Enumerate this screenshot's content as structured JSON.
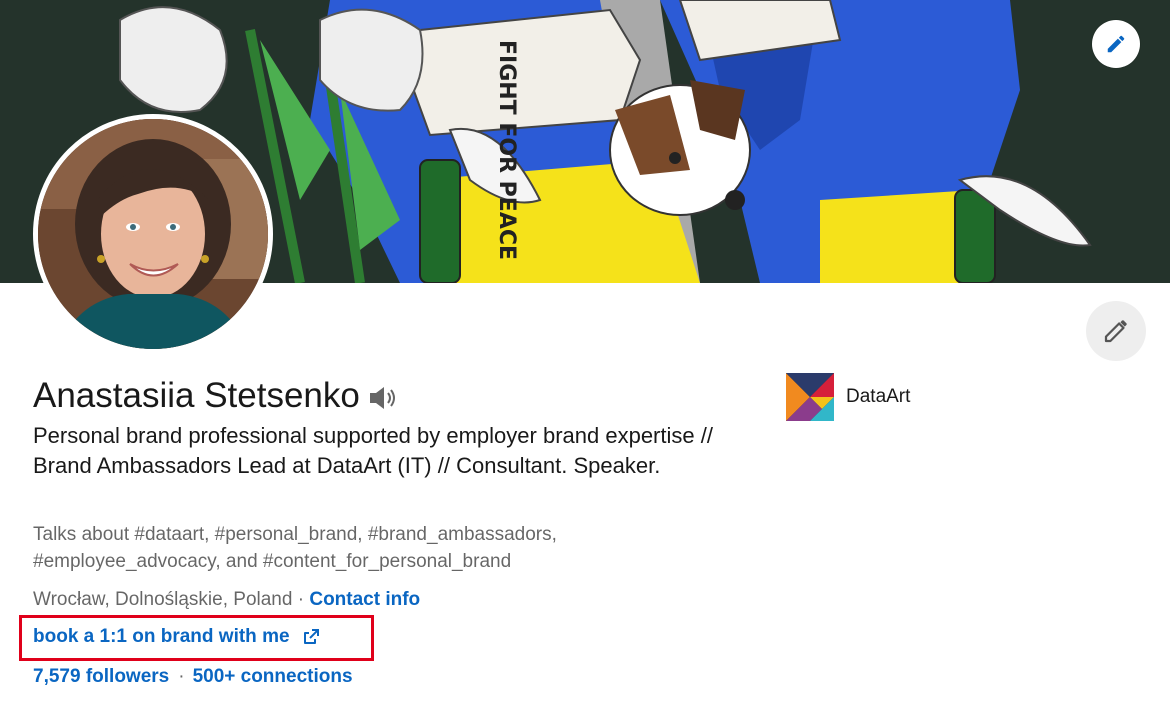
{
  "profile": {
    "name": "Anastasiia Stetsenko",
    "headline": "Personal brand professional supported by employer brand expertise // Brand Ambassadors Lead at DataArt (IT) // Consultant. Speaker.",
    "talks_about": "Talks about #dataart, #personal_brand, #brand_ambassadors, #employee_advocacy, and #content_for_personal_brand",
    "location": "Wrocław, Dolnośląskie, Poland",
    "location_separator": " · ",
    "contact_info_label": "Contact info",
    "website_label": "book a 1:1 on brand with me",
    "followers": "7,579 followers",
    "network_separator": "·",
    "connections": "500+ connections"
  },
  "banner": {
    "text": "FIGHT FOR PEACE"
  },
  "company": {
    "name": "DataArt"
  },
  "icons": {
    "banner_edit": "pencil-icon",
    "profile_edit": "pencil-icon",
    "name_pronunciation": "speaker-icon",
    "external_link": "external-link-icon",
    "company_logo": "dataart-logo"
  },
  "colors": {
    "link": "#0a66c2",
    "highlight_box": "#e0001a",
    "banner_bg": "#24332b",
    "ukraine_blue": "#2c5bd6",
    "ukraine_yellow": "#f5e21a"
  }
}
